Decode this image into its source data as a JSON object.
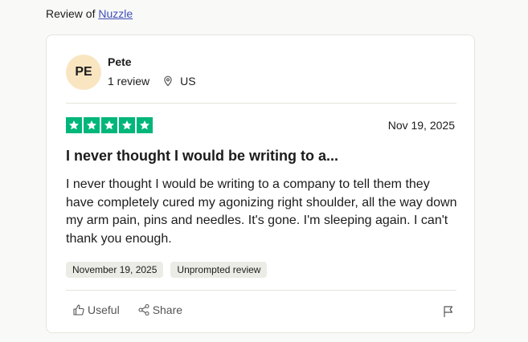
{
  "header": {
    "prefix": "Review of",
    "company": "Nuzzle"
  },
  "reviewer": {
    "initials": "PE",
    "name": "Pete",
    "review_count": "1 review",
    "location": "US"
  },
  "review": {
    "rating": 5,
    "date": "Nov 19, 2025",
    "title": "I never thought I would be writing to a...",
    "body": "I never thought I would be writing to a company to tell them they have completely cured my agonizing right shoulder, all the way down my arm pain, pins and needles. It's gone. I'm sleeping again. I can't thank you enough.",
    "tags": [
      "November 19, 2025",
      "Unprompted review"
    ]
  },
  "actions": {
    "useful": "Useful",
    "share": "Share"
  },
  "colors": {
    "star": "#00b67a",
    "avatar_bg": "#f9e6c1",
    "link": "#3e4fb9"
  },
  "icons": [
    "location-pin-icon",
    "star-icon",
    "thumbs-up-icon",
    "share-icon",
    "flag-icon"
  ]
}
